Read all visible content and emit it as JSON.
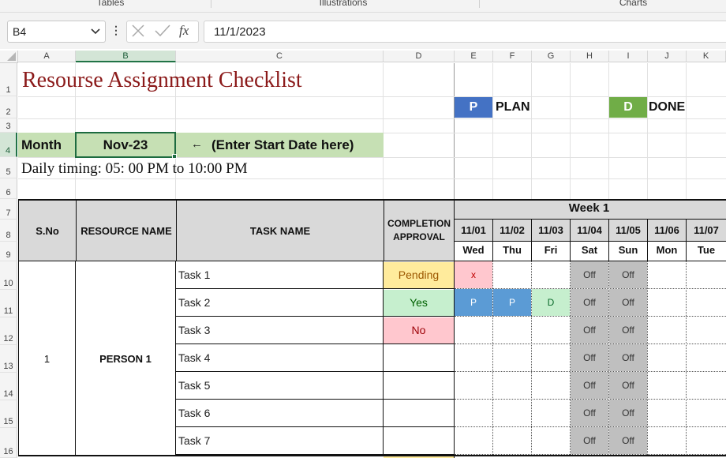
{
  "ribbon": {
    "groups": [
      "Tables",
      "Illustrations",
      "Charts"
    ]
  },
  "formula_bar": {
    "name_box": "B4",
    "fx": "fx",
    "content": "11/1/2023"
  },
  "columns": [
    "A",
    "B",
    "C",
    "D",
    "E",
    "F",
    "G",
    "H",
    "I",
    "J",
    "K"
  ],
  "rows": [
    "1",
    "2",
    "3",
    "4",
    "5",
    "6",
    "7",
    "8",
    "9",
    "10",
    "11",
    "12",
    "13",
    "14",
    "15",
    "16"
  ],
  "sheet": {
    "title": "Resourse Assignment Checklist",
    "legend": [
      {
        "key": "P",
        "label": "PLAN",
        "color": "#4472c4"
      },
      {
        "key": "D",
        "label": "DONE",
        "color": "#70ad47"
      }
    ],
    "month_label": "Month",
    "month_value": "Nov-23",
    "month_hint_arrow": "←",
    "month_hint": "(Enter Start Date here)",
    "daily_timing": "Daily timing: 05: 00 PM to 10:00 PM",
    "headers": {
      "sno": "S.No",
      "resource": "RESOURCE NAME",
      "task": "TASK NAME",
      "completion_line1": "COMPLETION",
      "completion_line2": "APPROVAL",
      "week": "Week 1"
    },
    "dates": [
      "11/01",
      "11/02",
      "11/03",
      "11/04",
      "11/05",
      "11/06",
      "11/07"
    ],
    "days": [
      "Wed",
      "Thu",
      "Fri",
      "Sat",
      "Sun",
      "Mon",
      "Tue"
    ],
    "group": {
      "sno": "1",
      "resource": "PERSON 1"
    },
    "tasks": [
      {
        "name": "Task 1",
        "status": "Pending",
        "marks": [
          "x",
          "",
          "",
          "Off",
          "Off",
          "",
          ""
        ]
      },
      {
        "name": "Task 2",
        "status": "Yes",
        "marks": [
          "P",
          "P",
          "D",
          "Off",
          "Off",
          "",
          ""
        ]
      },
      {
        "name": "Task 3",
        "status": "No",
        "marks": [
          "",
          "",
          "",
          "Off",
          "Off",
          "",
          ""
        ]
      },
      {
        "name": "Task 4",
        "status": "",
        "marks": [
          "",
          "",
          "",
          "Off",
          "Off",
          "",
          ""
        ]
      },
      {
        "name": "Task 5",
        "status": "",
        "marks": [
          "",
          "",
          "",
          "Off",
          "Off",
          "",
          ""
        ]
      },
      {
        "name": "Task 6",
        "status": "",
        "marks": [
          "",
          "",
          "",
          "Off",
          "Off",
          "",
          ""
        ]
      },
      {
        "name": "Task 7",
        "status": "",
        "marks": [
          "",
          "",
          "",
          "Off",
          "Off",
          "",
          ""
        ]
      }
    ],
    "colors": {
      "pending_bg": "#ffeb9c",
      "pending_fg": "#9c5700",
      "yes_bg": "#c6efce",
      "yes_fg": "#006100",
      "no_bg": "#ffc7ce",
      "no_fg": "#9c0006",
      "x_bg": "#ffc7ce",
      "x_fg": "#c00000",
      "plan_bg": "#5b9bd5",
      "done_bg": "#c6efce",
      "off_bg": "#bfbfbf"
    }
  }
}
